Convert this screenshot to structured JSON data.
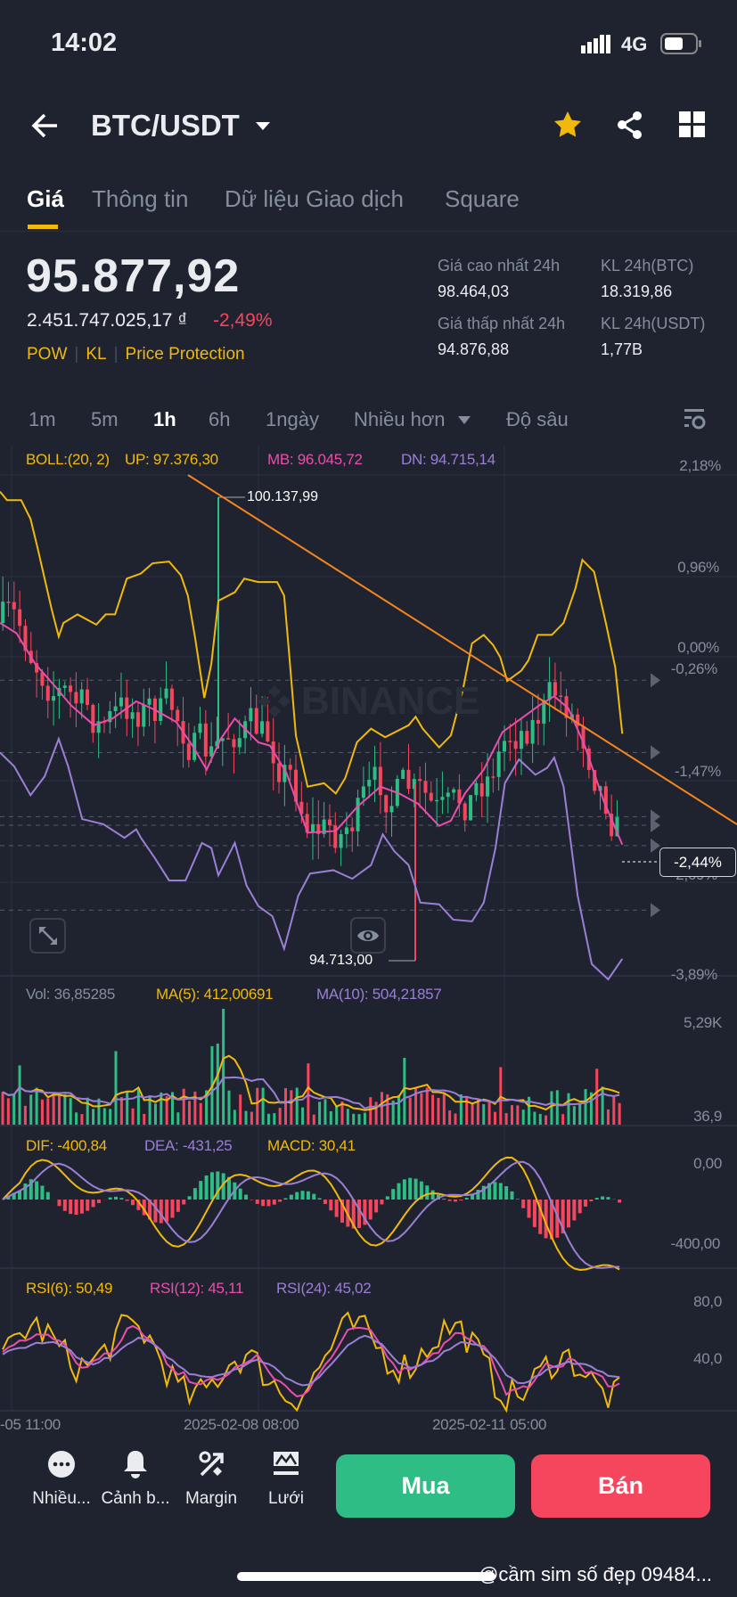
{
  "status_bar": {
    "time": "14:02",
    "network": "4G"
  },
  "header": {
    "pair": "BTC/USDT"
  },
  "tabs": [
    {
      "label": "Giá",
      "active": true
    },
    {
      "label": "Thông tin"
    },
    {
      "label": "Dữ liệu Giao dịch"
    },
    {
      "label": "Square"
    }
  ],
  "price": {
    "last": "95.877,92",
    "fiat": "2.451.747.025,17 ₫",
    "change": "-2,49%",
    "tags": [
      "POW",
      "KL",
      "Price Protection"
    ]
  },
  "stats": {
    "high_label": "Giá cao nhất 24h",
    "high": "98.464,03",
    "low_label": "Giá thấp nhất 24h",
    "low": "94.876,88",
    "vol_btc_label": "KL 24h(BTC)",
    "vol_btc": "18.319,86",
    "vol_usdt_label": "KL 24h(USDT)",
    "vol_usdt": "1,77B"
  },
  "intervals": {
    "items": [
      "1m",
      "5m",
      "1h",
      "6h",
      "1ngày"
    ],
    "active": "1h",
    "more": "Nhiều hơn",
    "depth": "Độ sâu"
  },
  "boll": {
    "label": "BOLL:(20, 2)",
    "up": "UP: 97.376,30",
    "mb": "MB: 96.045,72",
    "dn": "DN: 94.715,14"
  },
  "price_axis": [
    "2,18%",
    "0,96%",
    "0,00%",
    "-0,26%",
    "-1,47%",
    "-2,69%",
    "-3,89%"
  ],
  "current_change": "-2,44%",
  "high_marker": "100.137,99",
  "low_marker": "94.713,00",
  "watermark": "BINANCE",
  "volume": {
    "vol": "Vol: 36,85285",
    "ma5": "MA(5): 412,00691",
    "ma10": "MA(10): 504,21857",
    "axis_top": "5,29K",
    "axis_bottom": "36,9"
  },
  "macd": {
    "dif": "DIF: -400,84",
    "dea": "DEA: -431,25",
    "macd": "MACD: 30,41",
    "axis": [
      "0,00",
      "-400,00"
    ]
  },
  "rsi": {
    "rsi6": "RSI(6): 50,49",
    "rsi12": "RSI(12): 45,11",
    "rsi24": "RSI(24): 45,02",
    "axis": [
      "80,0",
      "40,0"
    ]
  },
  "time_axis": [
    "-05 11:00",
    "2025-02-08 08:00",
    "2025-02-11 05:00"
  ],
  "bottom_nav": [
    {
      "label": "Nhiều...",
      "icon": "more-icon"
    },
    {
      "label": "Cảnh b...",
      "icon": "bell-icon"
    },
    {
      "label": "Margin",
      "icon": "margin-icon"
    },
    {
      "label": "Lưới",
      "icon": "grid-trading-icon"
    }
  ],
  "buy_label": "Mua",
  "sell_label": "Bán",
  "overlay_text": "@cầm sim số đẹp 09484...",
  "colors": {
    "up": "#2ebd85",
    "down": "#f6465d",
    "accent": "#f0b90b",
    "mb": "#e84fac",
    "dn": "#9b7fd4",
    "trend": "#f7851f"
  }
}
